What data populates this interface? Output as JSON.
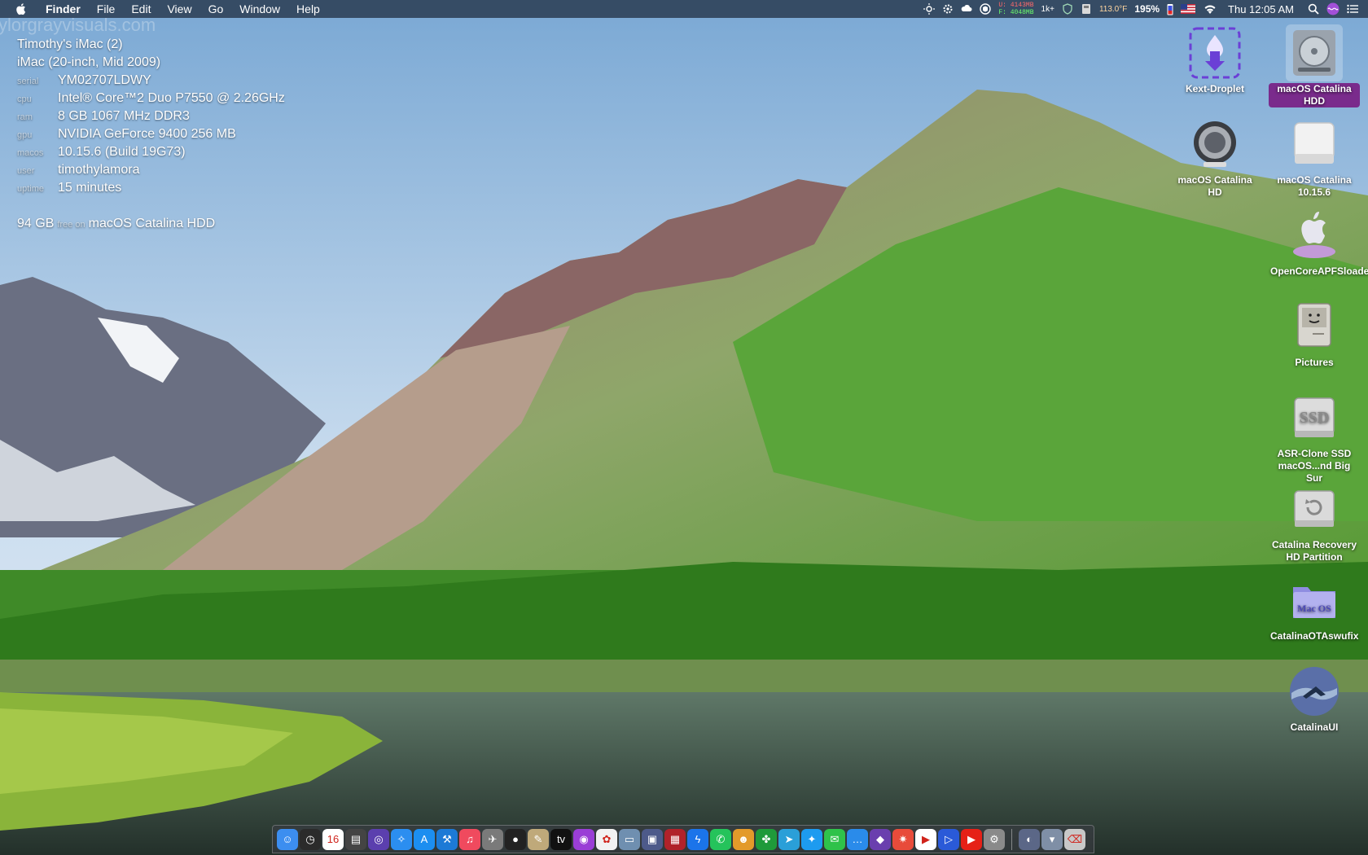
{
  "menubar": {
    "app": "Finder",
    "menus": [
      "File",
      "Edit",
      "View",
      "Go",
      "Window",
      "Help"
    ],
    "status": {
      "mem_used": "U: 4143MB",
      "mem_free": "F: 4048MB",
      "network": "1k+",
      "temp_battery": "113.0°F",
      "battery_percent": "195%",
      "clock": "Thu 12:05 AM"
    }
  },
  "watermark": "ylorgrayvisuals.com",
  "system_info": {
    "name": "Timothy's iMac (2)",
    "model": "iMac (20-inch, Mid 2009)",
    "rows": [
      {
        "key": "serial",
        "value": "YM02707LDWY"
      },
      {
        "key": "cpu",
        "value": "Intel® Core™2 Duo P7550 @ 2.26GHz"
      },
      {
        "key": "ram",
        "value": "8 GB 1067 MHz DDR3"
      },
      {
        "key": "gpu",
        "value": "NVIDIA GeForce 9400 256 MB"
      },
      {
        "key": "macos",
        "value": "10.15.6 (Build 19G73)"
      },
      {
        "key": "user",
        "value": "timothylamora"
      },
      {
        "key": "uptime",
        "value": "15 minutes"
      }
    ],
    "disk_free": "94 GB",
    "disk_free_label": "free on",
    "disk_name": "macOS Catalina HDD"
  },
  "desktop_icons": [
    {
      "id": "kext-droplet",
      "label": "Kext-Droplet",
      "icon": "droplet-download-icon",
      "color": "#6b3fd6"
    },
    {
      "id": "macos-catalina-hdd",
      "label": "macOS Catalina HDD",
      "icon": "internal-drive-icon",
      "color": "#9aa3ad",
      "selected": true
    },
    {
      "id": "macos-catalina-hd",
      "label": "macOS Catalina HD",
      "icon": "external-drive-icon",
      "color": "#8c9096"
    },
    {
      "id": "macos-catalina-1056",
      "label": "macOS Catalina 10.15.6",
      "icon": "disk-image-icon",
      "color": "#e8e8e8"
    },
    {
      "id": "opencore",
      "label": "OpenCoreAPFSloader3",
      "icon": "apple-loader-icon",
      "color": "#c39ad8"
    },
    {
      "id": "pictures",
      "label": "Pictures",
      "icon": "classic-mac-icon",
      "color": "#d8d6cf"
    },
    {
      "id": "asr-clone",
      "label": "ASR-Clone SSD macOS...nd Big Sur",
      "icon": "ssd-drive-icon",
      "color": "#cfcfcf"
    },
    {
      "id": "catalina-recovery",
      "label": "Catalina Recovery HD Partition",
      "icon": "recovery-drive-icon",
      "color": "#d0d0d0"
    },
    {
      "id": "catalina-ota",
      "label": "CatalinaOTAswufix",
      "icon": "macos-folder-icon",
      "color": "#7d7bd6"
    },
    {
      "id": "catalina-ui",
      "label": "CatalinaUI",
      "icon": "catalina-app-icon",
      "color": "#5a6fa8"
    }
  ],
  "dock": {
    "apps": [
      {
        "name": "finder-icon",
        "color": "#3c8ef0",
        "glyph": "☺"
      },
      {
        "name": "clock-icon",
        "color": "#2b2b2b",
        "glyph": "◷"
      },
      {
        "name": "calendar-icon",
        "color": "#ffffff",
        "glyph": "16"
      },
      {
        "name": "system-monitor-icon",
        "color": "#444444",
        "glyph": "▤"
      },
      {
        "name": "siri-icon",
        "color": "#5b3fae",
        "glyph": "◎"
      },
      {
        "name": "safari-icon",
        "color": "#2b8ef0",
        "glyph": "✧"
      },
      {
        "name": "app-store-icon",
        "color": "#1c8ef0",
        "glyph": "A"
      },
      {
        "name": "xcode-icon",
        "color": "#1c7ad6",
        "glyph": "⚒"
      },
      {
        "name": "music-icon",
        "color": "#f04a5e",
        "glyph": "♫"
      },
      {
        "name": "launchpad-icon",
        "color": "#7a7a7a",
        "glyph": "✈"
      },
      {
        "name": "camera-icon",
        "color": "#222222",
        "glyph": "●"
      },
      {
        "name": "preview-icon",
        "color": "#bfa97a",
        "glyph": "✎"
      },
      {
        "name": "apple-tv-icon",
        "color": "#111111",
        "glyph": "tv"
      },
      {
        "name": "podcasts-icon",
        "color": "#9a3ed6",
        "glyph": "◉"
      },
      {
        "name": "photos-icon",
        "color": "#f2f2f2",
        "glyph": "✿"
      },
      {
        "name": "preview2-icon",
        "color": "#6f8fb0",
        "glyph": "▭"
      },
      {
        "name": "screenshot-icon",
        "color": "#4d5a8a",
        "glyph": "▣"
      },
      {
        "name": "photo-booth-icon",
        "color": "#b0222a",
        "glyph": "▦"
      },
      {
        "name": "messenger-icon",
        "color": "#1b74ea",
        "glyph": "ϟ"
      },
      {
        "name": "whatsapp-icon",
        "color": "#25c35b",
        "glyph": "✆"
      },
      {
        "name": "discord-icon",
        "color": "#e39a2a",
        "glyph": "☻"
      },
      {
        "name": "clover-icon",
        "color": "#1f9a3a",
        "glyph": "✤"
      },
      {
        "name": "telegram-icon",
        "color": "#2a9fd8",
        "glyph": "➤"
      },
      {
        "name": "twitter-icon",
        "color": "#1d9bf0",
        "glyph": "✦"
      },
      {
        "name": "messages-icon",
        "color": "#2fc24a",
        "glyph": "✉"
      },
      {
        "name": "chat-icon",
        "color": "#2a8bea",
        "glyph": "…"
      },
      {
        "name": "shortcut-icon",
        "color": "#6a3fae",
        "glyph": "◆"
      },
      {
        "name": "popcorn-icon",
        "color": "#e84b3a",
        "glyph": "✷"
      },
      {
        "name": "video-icon",
        "color": "#ffffff",
        "glyph": "▶"
      },
      {
        "name": "infuse-icon",
        "color": "#2a5ad8",
        "glyph": "▷"
      },
      {
        "name": "youtube-icon",
        "color": "#e62117",
        "glyph": "▶"
      },
      {
        "name": "system-preferences-icon",
        "color": "#8a8a8a",
        "glyph": "⚙"
      }
    ],
    "others": [
      {
        "name": "catalina-wallpaper-icon",
        "color": "#5b6787",
        "glyph": "◐"
      },
      {
        "name": "downloads-stack-icon",
        "color": "#7f8fa6",
        "glyph": "▾"
      },
      {
        "name": "trash-icon",
        "color": "#c8c8c8",
        "glyph": "⌫"
      }
    ]
  }
}
